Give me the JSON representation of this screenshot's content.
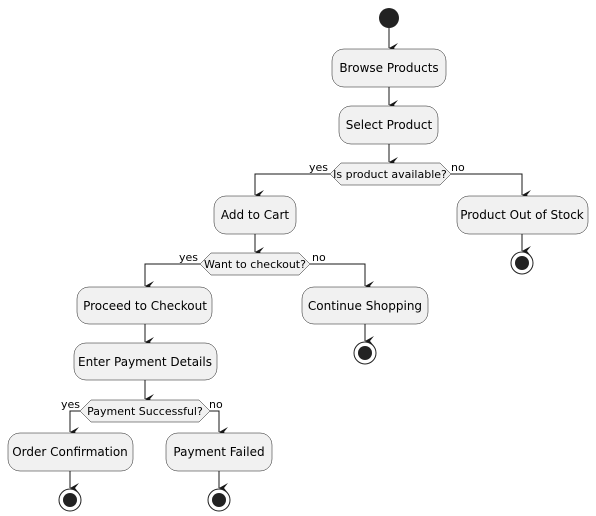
{
  "diagram": {
    "type": "activity",
    "nodes": {
      "start": {
        "kind": "start"
      },
      "browse": {
        "label": "Browse Products"
      },
      "select": {
        "label": "Select Product"
      },
      "d_available": {
        "label": "Is product available?",
        "yes": "yes",
        "no": "no"
      },
      "add_cart": {
        "label": "Add to Cart"
      },
      "out_of_stock": {
        "label": "Product Out of Stock"
      },
      "d_checkout": {
        "label": "Want to checkout?",
        "yes": "yes",
        "no": "no"
      },
      "proceed": {
        "label": "Proceed to Checkout"
      },
      "continue": {
        "label": "Continue Shopping"
      },
      "payment": {
        "label": "Enter Payment Details"
      },
      "d_payment": {
        "label": "Payment Successful?",
        "yes": "yes",
        "no": "no"
      },
      "confirm": {
        "label": "Order Confirmation"
      },
      "failed": {
        "label": "Payment Failed"
      }
    },
    "edges": [
      [
        "start",
        "browse"
      ],
      [
        "browse",
        "select"
      ],
      [
        "select",
        "d_available"
      ],
      [
        "d_available",
        "add_cart",
        "yes"
      ],
      [
        "d_available",
        "out_of_stock",
        "no"
      ],
      [
        "out_of_stock",
        "end"
      ],
      [
        "add_cart",
        "d_checkout"
      ],
      [
        "d_checkout",
        "proceed",
        "yes"
      ],
      [
        "d_checkout",
        "continue",
        "no"
      ],
      [
        "continue",
        "end"
      ],
      [
        "proceed",
        "payment"
      ],
      [
        "payment",
        "d_payment"
      ],
      [
        "d_payment",
        "confirm",
        "yes"
      ],
      [
        "d_payment",
        "failed",
        "no"
      ],
      [
        "confirm",
        "end"
      ],
      [
        "failed",
        "end"
      ]
    ],
    "colors": {
      "node_fill": "#f1f1f1",
      "stroke": "#181818",
      "terminal": "#222222"
    }
  }
}
